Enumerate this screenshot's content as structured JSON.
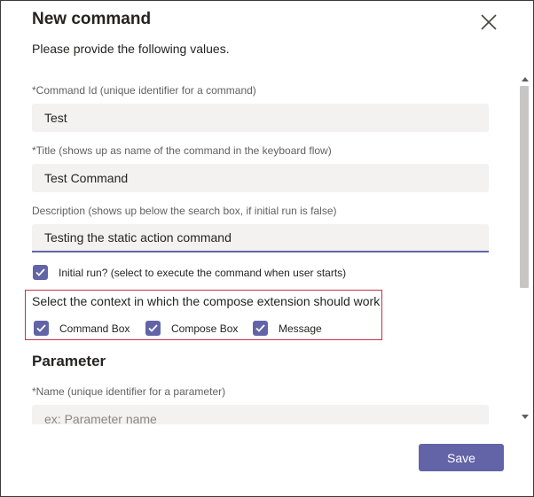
{
  "dialog": {
    "title": "New command",
    "subtitle": "Please provide the following values."
  },
  "fields": {
    "command_id": {
      "label": "*Command Id (unique identifier for a command)",
      "value": "Test"
    },
    "title": {
      "label": "*Title (shows up as name of the command in the keyboard flow)",
      "value": "Test Command"
    },
    "description": {
      "label": "Description (shows up below the search box, if initial run is false)",
      "value": "Testing the static action command"
    }
  },
  "initial_run": {
    "label": "Initial run? (select to execute the command when user starts)",
    "checked": true
  },
  "context": {
    "title": "Select the context in which the compose extension should work",
    "options": [
      {
        "label": "Command Box",
        "checked": true
      },
      {
        "label": "Compose Box",
        "checked": true
      },
      {
        "label": "Message",
        "checked": true
      }
    ]
  },
  "parameter": {
    "heading": "Parameter",
    "name_label": "*Name (unique identifier for a parameter)",
    "name_placeholder": "ex: Parameter name"
  },
  "actions": {
    "save_label": "Save"
  },
  "colors": {
    "accent": "#6264a7",
    "highlight_border": "#c4314b"
  }
}
